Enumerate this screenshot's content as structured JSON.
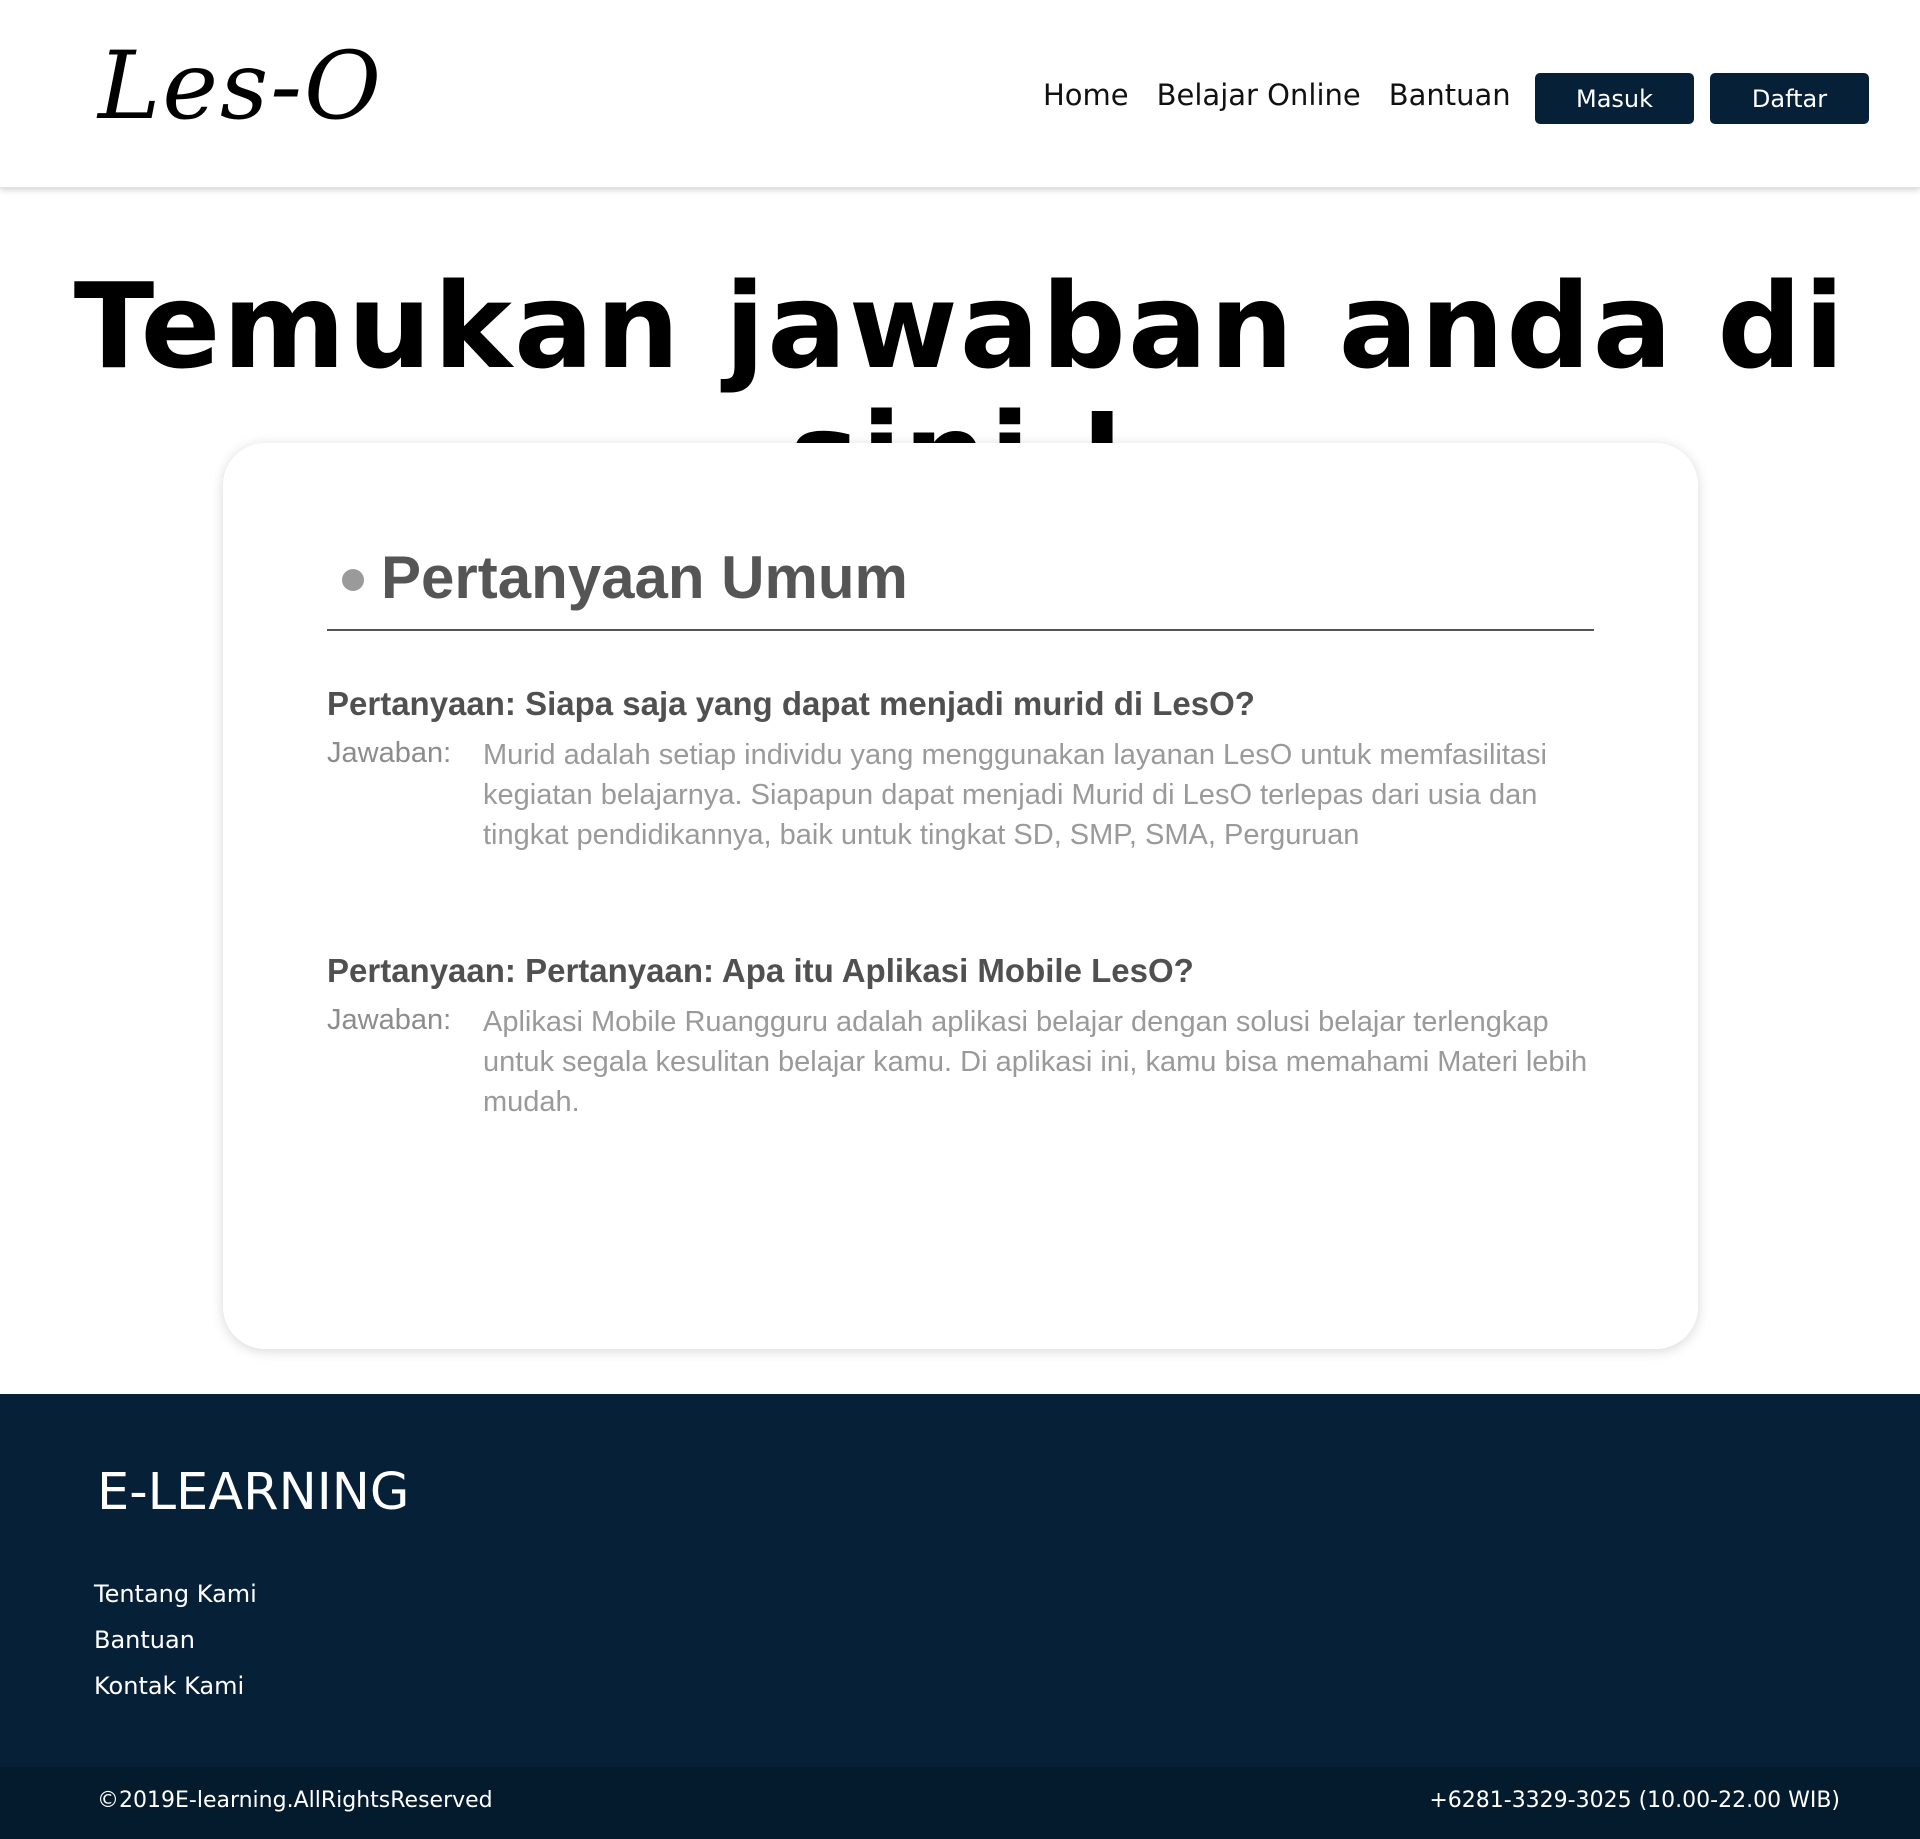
{
  "header": {
    "logo": "Les-O",
    "nav": [
      "Home",
      "Belajar Online",
      "Bantuan"
    ],
    "login_label": "Masuk",
    "register_label": "Daftar"
  },
  "hero": {
    "title": "Temukan jawaban anda di sini !"
  },
  "faq": {
    "section_title": "Pertanyaan Umum",
    "items": [
      {
        "question": "Pertanyaan: Siapa saja yang dapat menjadi murid di LesO?",
        "answer_label": "Jawaban:",
        "answer": "Murid adalah setiap individu yang menggunakan layanan LesO untuk memfasilitasi kegiatan belajarnya. Siapapun dapat menjadi Murid di LesO terlepas dari usia dan tingkat pendidikannya, baik untuk tingkat SD, SMP, SMA, Perguruan"
      },
      {
        "question": "Pertanyaan: Pertanyaan: Apa itu Aplikasi Mobile LesO?",
        "answer_label": "Jawaban:",
        "answer": "Aplikasi Mobile Ruangguru adalah aplikasi belajar dengan solusi belajar terlengkap untuk segala kesulitan belajar kamu. Di aplikasi ini, kamu bisa memahami Materi lebih mudah."
      }
    ]
  },
  "footer": {
    "brand": "E-LEARNING",
    "links": [
      "Tentang Kami",
      "Bantuan",
      "Kontak Kami"
    ],
    "copyright": "©2019E-learning.AllRightsReserved",
    "phone": "+6281-3329-3025 (10.00-22.00 WIB)"
  },
  "colors": {
    "navy": "#062038",
    "footer_bottom": "#041a2d",
    "question_text": "#505050",
    "answer_text": "#9a9a9a"
  }
}
